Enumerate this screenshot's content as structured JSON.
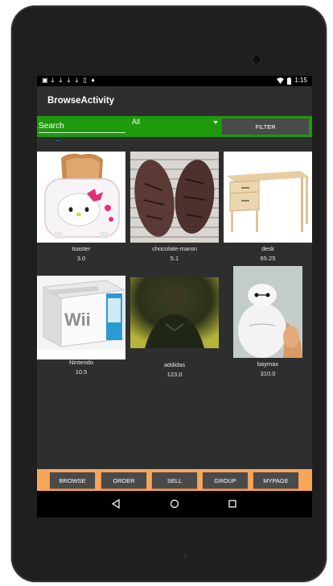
{
  "status_bar": {
    "left_icons": [
      "image-icon",
      "download-icon",
      "download-icon",
      "download-icon",
      "download-icon",
      "sd-card-icon",
      "location-icon"
    ],
    "time": "1:15"
  },
  "app_bar": {
    "title": "BrowseActivity"
  },
  "filter_bar": {
    "search_placeholder": "Search",
    "category_value": "All",
    "filter_label": "FILTER"
  },
  "items": [
    {
      "name": "toaster",
      "price": "3.0"
    },
    {
      "name": "chocolate-maron",
      "price": "5.1"
    },
    {
      "name": "desk",
      "price": "65.25"
    },
    {
      "name": "Nintendo",
      "price": "10.5"
    },
    {
      "name": "addidas",
      "price": "123.0"
    },
    {
      "name": "baymax",
      "price": "310.0"
    }
  ],
  "image_text": {
    "wii": "Wii"
  },
  "bottom_nav": {
    "browse": "BROWSE",
    "order": "ORDER",
    "sell": "SELL",
    "group": "GROUP",
    "mypage": "MYPAGE"
  },
  "colors": {
    "filter_bar": "#1e9a0c",
    "bottom_nav": "#f7a65a",
    "button": "#4a4a4a",
    "screen_bg": "#2e2e2e"
  }
}
